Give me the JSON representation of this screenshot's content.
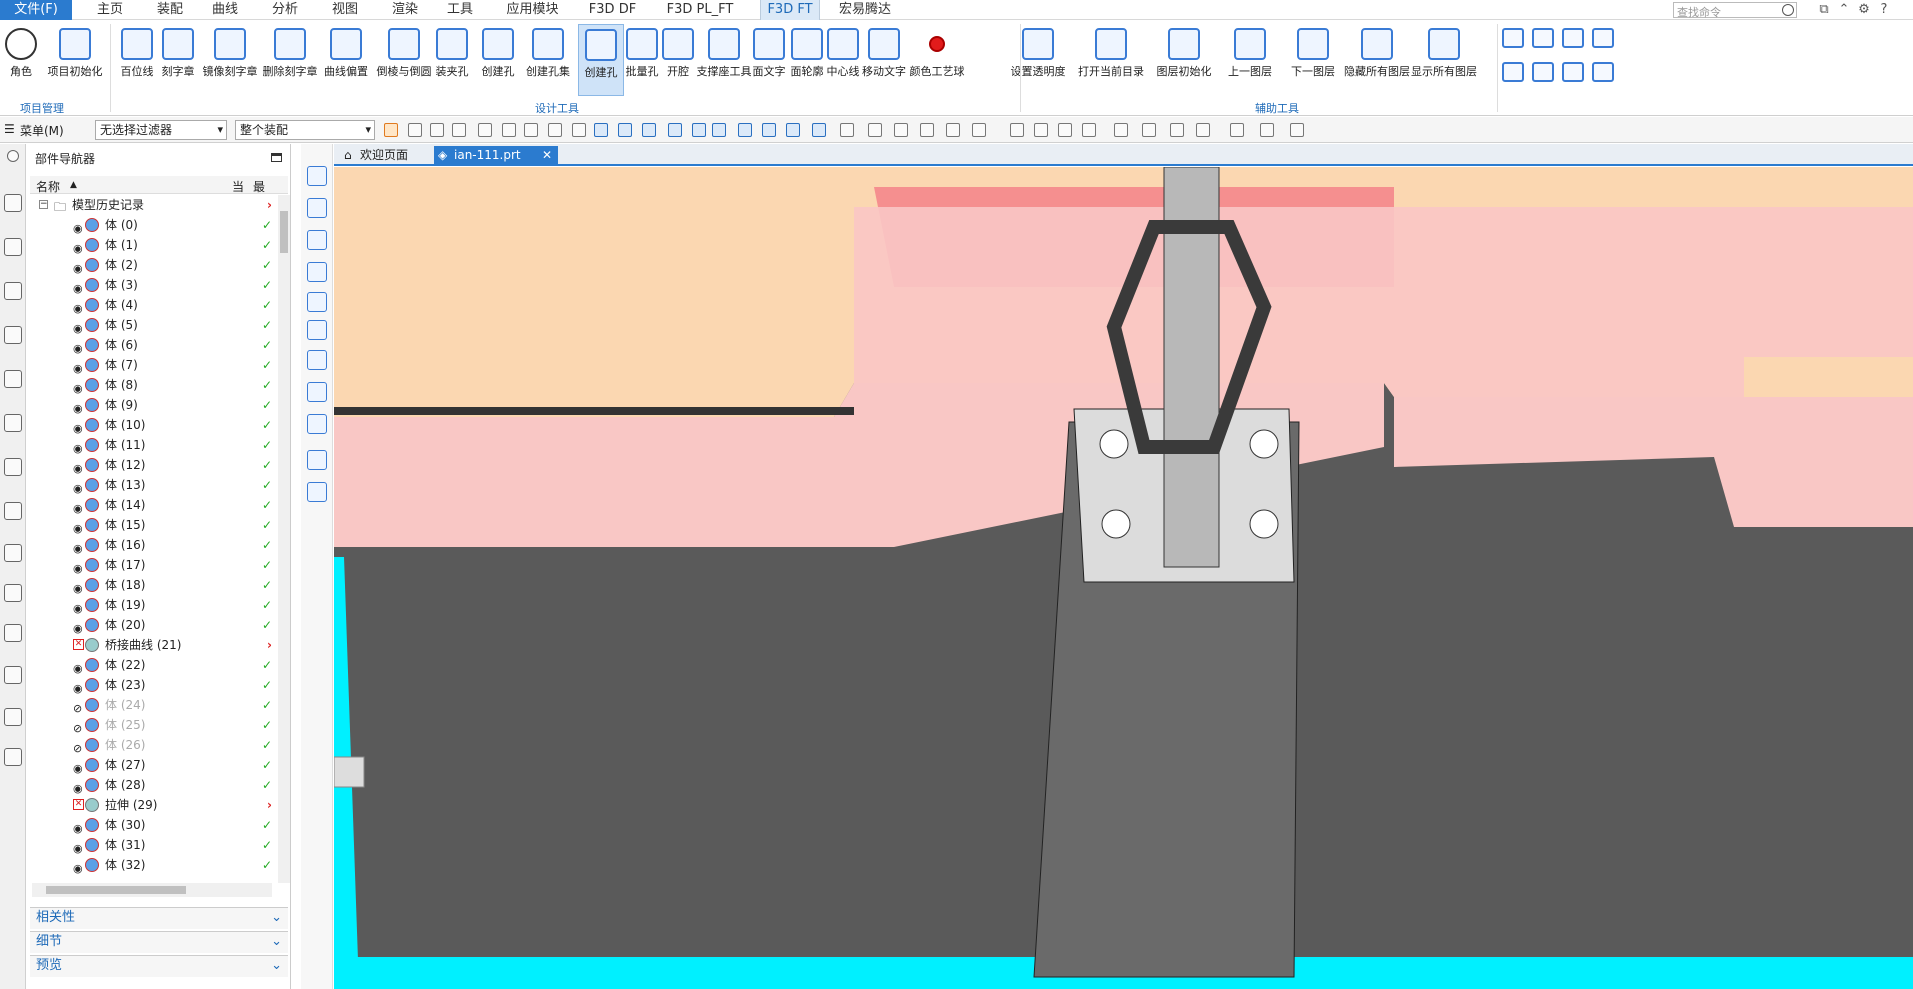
{
  "menubar": {
    "tabs": [
      "文件(F)",
      "主页",
      "装配",
      "曲线",
      "分析",
      "视图",
      "渲染",
      "工具",
      "应用模块",
      "F3D DF",
      "F3D PL_FT",
      "F3D FT",
      "宏易腾达"
    ],
    "active": "F3D FT",
    "search_placeholder": "查找命令"
  },
  "ribbon": {
    "buttons": [
      "角色",
      "项目初始化",
      "百位线",
      "刻字章",
      "镜像刻字章",
      "删除刻字章",
      "曲线偏置",
      "倒棱与倒圆",
      "装夹孔",
      "创建孔",
      "创建孔集",
      "创建孔",
      "批量孔",
      "开腔",
      "支撑座工具",
      "面文字",
      "面轮廓",
      "中心线",
      "移动文字",
      "颜色工艺球",
      "设置透明度",
      "打开当前目录",
      "图层初始化",
      "上一图层",
      "下一图层",
      "隐藏所有图层",
      "显示所有图层"
    ],
    "groups": [
      "项目管理",
      "设计工具",
      "辅助工具"
    ]
  },
  "toolbar2": {
    "menu_label": "菜单(M)",
    "filter_value": "无选择过滤器",
    "assembly_value": "整个装配"
  },
  "navigator": {
    "title": "部件导航器",
    "columns": [
      "名称",
      "当",
      "最"
    ],
    "rows": [
      {
        "text": "模型历史记录",
        "kind": "folder",
        "status": "red"
      },
      {
        "text": "体 (0)",
        "kind": "body",
        "status": "ok"
      },
      {
        "text": "体 (1)",
        "kind": "body",
        "status": "ok"
      },
      {
        "text": "体 (2)",
        "kind": "body",
        "status": "ok"
      },
      {
        "text": "体 (3)",
        "kind": "body",
        "status": "ok"
      },
      {
        "text": "体 (4)",
        "kind": "body",
        "status": "ok"
      },
      {
        "text": "体 (5)",
        "kind": "body",
        "status": "ok"
      },
      {
        "text": "体 (6)",
        "kind": "body",
        "status": "ok"
      },
      {
        "text": "体 (7)",
        "kind": "body",
        "status": "ok"
      },
      {
        "text": "体 (8)",
        "kind": "body",
        "status": "ok"
      },
      {
        "text": "体 (9)",
        "kind": "body",
        "status": "ok"
      },
      {
        "text": "体 (10)",
        "kind": "body",
        "status": "ok"
      },
      {
        "text": "体 (11)",
        "kind": "body",
        "status": "ok"
      },
      {
        "text": "体 (12)",
        "kind": "body",
        "status": "ok"
      },
      {
        "text": "体 (13)",
        "kind": "body",
        "status": "ok"
      },
      {
        "text": "体 (14)",
        "kind": "body",
        "status": "ok"
      },
      {
        "text": "体 (15)",
        "kind": "body",
        "status": "ok"
      },
      {
        "text": "体 (16)",
        "kind": "body",
        "status": "ok"
      },
      {
        "text": "体 (17)",
        "kind": "body",
        "status": "ok"
      },
      {
        "text": "体 (18)",
        "kind": "body",
        "status": "ok"
      },
      {
        "text": "体 (19)",
        "kind": "body",
        "status": "ok"
      },
      {
        "text": "体 (20)",
        "kind": "body",
        "status": "ok"
      },
      {
        "text": "桥接曲线 (21)",
        "kind": "error",
        "status": "red"
      },
      {
        "text": "体 (22)",
        "kind": "body",
        "status": "ok"
      },
      {
        "text": "体 (23)",
        "kind": "body",
        "status": "ok"
      },
      {
        "text": "体 (24)",
        "kind": "dim",
        "status": "ok"
      },
      {
        "text": "体 (25)",
        "kind": "dim",
        "status": "ok"
      },
      {
        "text": "体 (26)",
        "kind": "dim",
        "status": "ok"
      },
      {
        "text": "体 (27)",
        "kind": "body",
        "status": "ok"
      },
      {
        "text": "体 (28)",
        "kind": "body",
        "status": "ok"
      },
      {
        "text": "拉伸 (29)",
        "kind": "error",
        "status": "red"
      },
      {
        "text": "体 (30)",
        "kind": "body",
        "status": "ok"
      },
      {
        "text": "体 (31)",
        "kind": "body",
        "status": "ok"
      },
      {
        "text": "体 (32)",
        "kind": "body",
        "status": "ok"
      }
    ],
    "panels": [
      "相关性",
      "细节",
      "预览"
    ]
  },
  "doc_tabs": [
    "欢迎页面",
    "ian-111.prt"
  ],
  "colors": {
    "accent": "#2b7bcf",
    "mold_top": "#fbd7b1",
    "mold_pink": "#f9c7c5",
    "mold_dark": "#5a5a5a",
    "cyan": "#00f0ff"
  }
}
